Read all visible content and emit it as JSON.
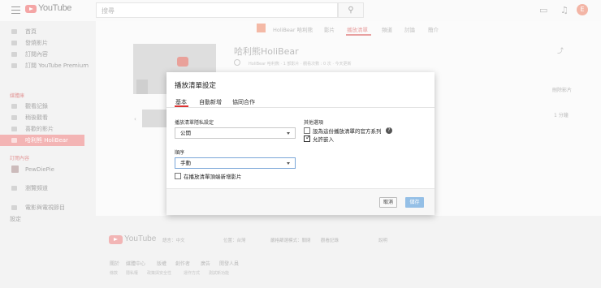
{
  "masthead": {
    "logo_text": "YouTube",
    "search_placeholder": "搜尋",
    "avatar_letter": "E"
  },
  "sidebar": {
    "items_main": [
      "首頁",
      "發燒影片",
      "訂閱內容",
      "訂閱 YouTube Premium"
    ],
    "library_header": "媒體庫",
    "items_library": [
      "觀看記錄",
      "稍後觀看",
      "喜歡的影片",
      "哈利熊 HoliBear"
    ],
    "subs_header": "訂閱內容",
    "items_subs": [
      "PewDiePie"
    ],
    "items_bottom": [
      "瀏覽頻道",
      "電影與電視節目",
      "設定"
    ]
  },
  "channel_bar": {
    "name": "HoliBear 哈利熊",
    "tabs": [
      "影片",
      "播放清單",
      "頻道",
      "討論",
      "簡介"
    ],
    "active_tab": "播放清單"
  },
  "playlist": {
    "title": "哈利熊HoliBear",
    "meta": "HoliBear 哈利熊 · 1 部影片 · 觀看次數 : 0 次 · 今天更新",
    "side_text_1": "刪除影片",
    "side_text_2": "1 分鐘"
  },
  "dialog": {
    "title": "播放清單設定",
    "tabs": [
      "基本",
      "自動新增",
      "協同合作"
    ],
    "privacy_label": "播放清單隱私設定",
    "privacy_value": "公開",
    "order_label": "順序",
    "order_value": "手動",
    "add_to_top_label": "在播放清單頂端新增影片",
    "add_to_top_checked": false,
    "other_options_label": "其他選項",
    "official_series_label": "設為這份播放清單的官方系列",
    "official_series_checked": false,
    "allow_embed_label": "允許嵌入",
    "allow_embed_checked": true,
    "cancel_label": "取消",
    "save_label": "儲存"
  },
  "page_footer": {
    "logo_text": "YouTube",
    "language": "語言：中文",
    "location": "位置：台灣",
    "restricted": "嚴格篩選模式：關閉",
    "history": "觀看記錄",
    "help": "說明",
    "links_row1": [
      "關於",
      "媒體中心",
      "版權",
      "創作者",
      "廣告",
      "開發人員"
    ],
    "links_row2": [
      "條款",
      "隱私權",
      "政策與安全性",
      "運作方式",
      "測試新功能"
    ]
  },
  "colors": {
    "brand_red": "#d33",
    "save_blue": "#94bfe6",
    "focus_blue": "#7aa6d8"
  }
}
